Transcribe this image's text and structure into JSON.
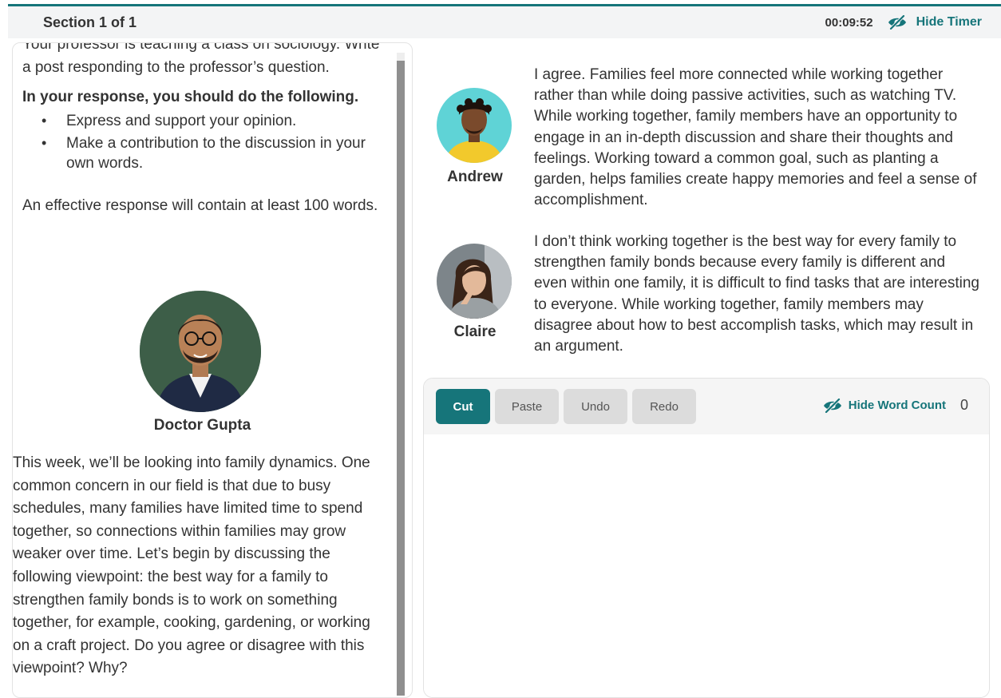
{
  "header": {
    "section_title": "Section 1 of 1",
    "timer": "00:09:52",
    "hide_timer_label": "Hide Timer",
    "accent_color": "#16757a"
  },
  "prompt": {
    "intro": "Your professor is teaching a class on sociology. Write a post responding to the professor’s question.",
    "heading": "In your response, you should do the following.",
    "bullets": [
      "Express and support your opinion.",
      "Make a contribution to the discussion in your own words."
    ],
    "effective": "An effective response will contain at least 100 words."
  },
  "professor": {
    "name": "Doctor Gupta",
    "text": "This week, we’ll be looking into family dynamics. One common concern in our field is that due to busy schedules, many families have limited time to spend together, so connections within families may grow weaker over time. Let’s begin by discussing the following viewpoint: the best way for a family to strengthen family bonds is to work on something together, for example, cooking, gardening, or working on a craft project. Do you agree or disagree with this viewpoint? Why?"
  },
  "posts": [
    {
      "name": "Andrew",
      "text": "I agree. Families feel more connected while working together rather than while doing passive activities, such as watching TV. While working together, family members have an opportunity to engage in an in-depth discussion and share their thoughts and feelings. Working toward a common goal, such as planting a garden, helps families create happy memories and feel a sense of accomplishment."
    },
    {
      "name": "Claire",
      "text": "I don’t think working together is the best way for every family to strengthen family bonds because every family is different and even within one family, it is difficult to find tasks that are interesting to everyone. While working together, family members may disagree about how to best accomplish tasks, which may result in an argument."
    }
  ],
  "editor": {
    "buttons": {
      "cut": "Cut",
      "paste": "Paste",
      "undo": "Undo",
      "redo": "Redo"
    },
    "hide_word_count_label": "Hide Word Count",
    "word_count": "0",
    "content": ""
  },
  "icons": {
    "timer_toggle": "eye-slash-icon",
    "word_count_toggle": "eye-slash-icon"
  }
}
